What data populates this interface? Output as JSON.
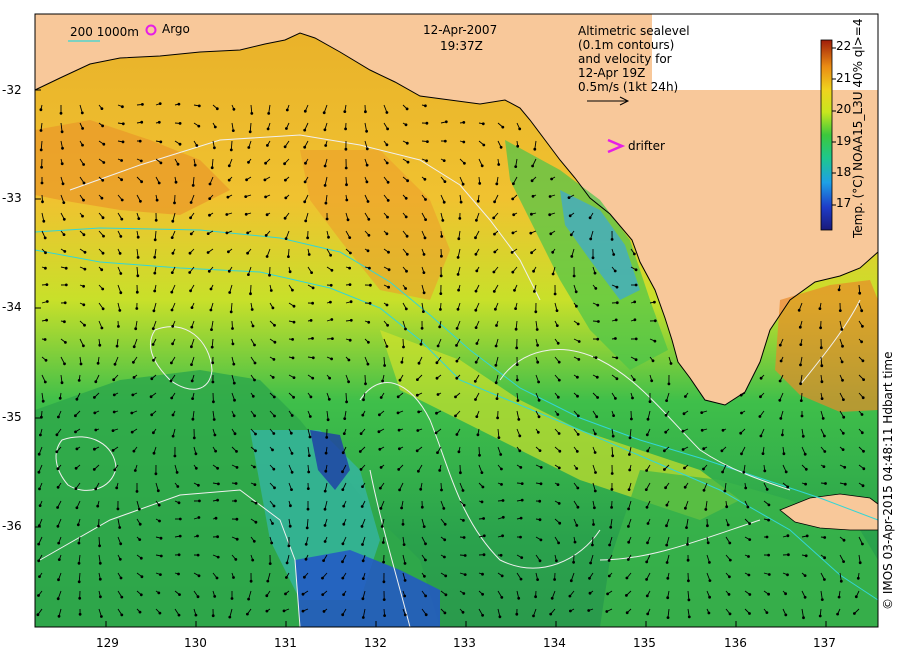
{
  "annotations": {
    "bathymetry_legend": "200  1000m",
    "argo_label": "Argo",
    "date": "12-Apr-2007",
    "time": "19:37Z",
    "altimetry_note": [
      "Altimetric sealevel",
      "(0.1m contours)",
      "and velocity for",
      "12-Apr 19Z"
    ],
    "velocity_scale": "0.5m/s (1kt 24h)",
    "drifter_label": "drifter",
    "credit": "© IMOS 03-Apr-2015 04:48:11 Hdbart time"
  },
  "colorbar": {
    "title": "Temp. (°C) NOAA15_L3U 40% ql>=4",
    "ticks": [
      "22",
      "21",
      "20",
      "19",
      "18",
      "17"
    ],
    "range": [
      16.5,
      22.5
    ]
  },
  "axes": {
    "lat_labels": [
      "-32",
      "-33",
      "-34",
      "-35",
      "-36"
    ],
    "lon_labels": [
      "129",
      "130",
      "131",
      "132",
      "133",
      "134",
      "135",
      "136",
      "137"
    ]
  },
  "colors": {
    "land": "#f8c89a",
    "bathymetry_contour": "#33d6d6",
    "sealevel_contour": "#f0f0f0",
    "marker": "#e61ee6"
  }
}
